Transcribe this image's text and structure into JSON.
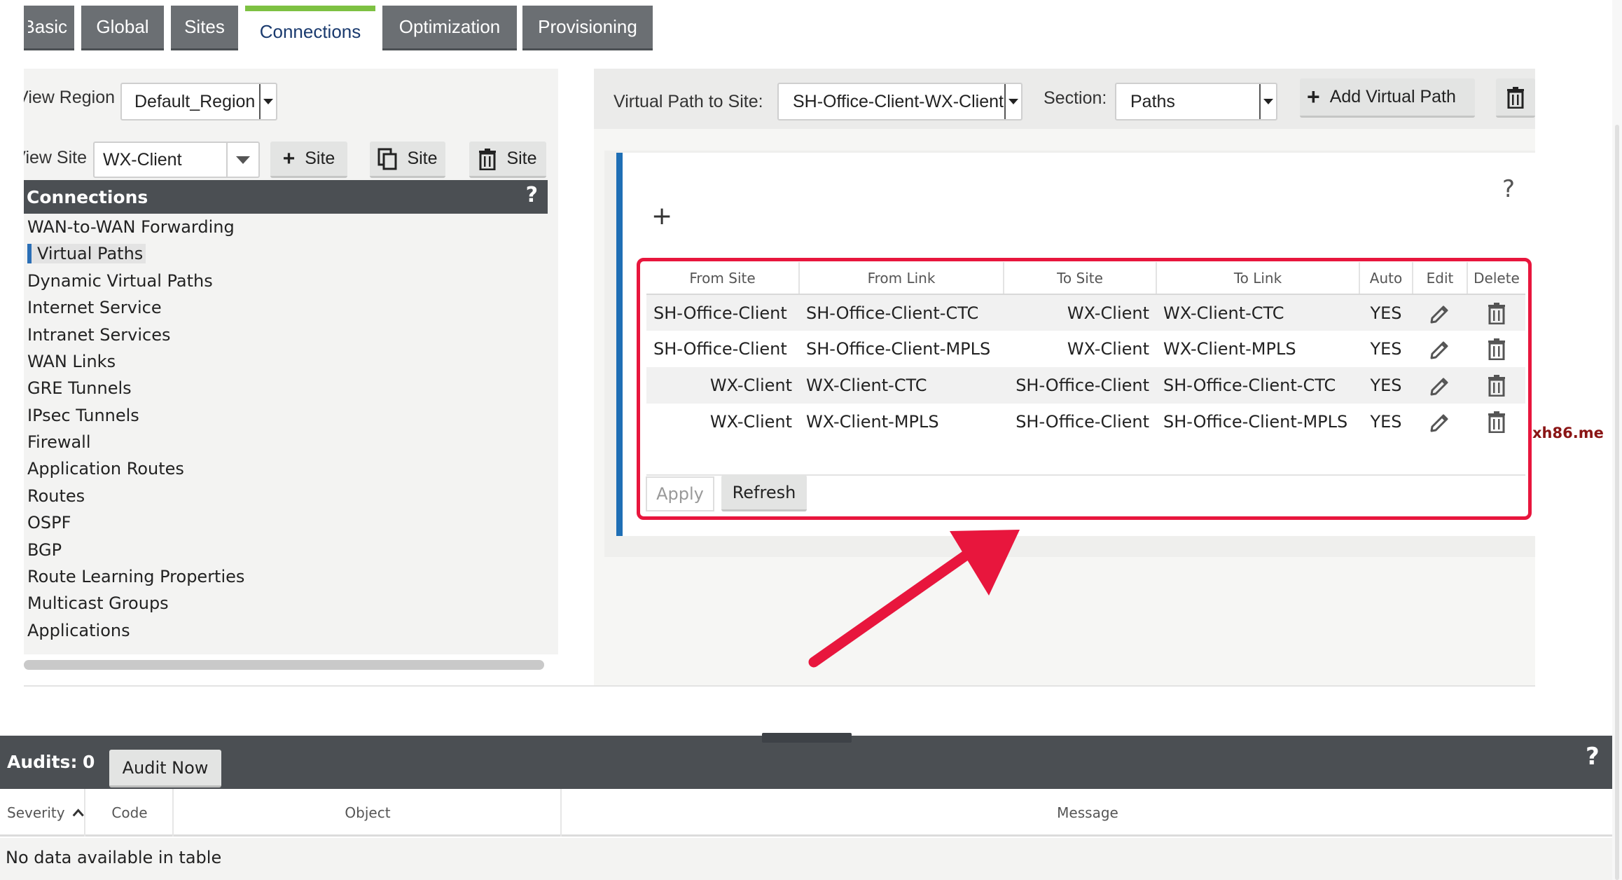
{
  "tabs": [
    "Basic",
    "Global",
    "Sites",
    "Connections",
    "Optimization",
    "Provisioning"
  ],
  "left": {
    "view_region_label": "View Region:",
    "view_region_value": "Default_Region",
    "view_site_label": "View Site:",
    "view_site_value": "WX-Client",
    "add_site": "Site",
    "clone_site": "Site",
    "delete_site": "Site",
    "connections_title": "Connections",
    "help": "?",
    "nav": [
      "WAN-to-WAN Forwarding",
      "Virtual Paths",
      "Dynamic Virtual Paths",
      "Internet Service",
      "Intranet Services",
      "WAN Links",
      "GRE Tunnels",
      "IPsec Tunnels",
      "Firewall",
      "Application Routes",
      "Routes",
      "OSPF",
      "BGP",
      "Route Learning Properties",
      "Multicast Groups",
      "Applications"
    ]
  },
  "toolbar": {
    "vp_label": "Virtual Path to Site:",
    "vp_value": "SH-Office-Client-WX-Client",
    "section_label": "Section:",
    "section_value": "Paths",
    "add_vp": "Add Virtual Path"
  },
  "paths": {
    "add": "+",
    "help": "?",
    "columns": [
      "From Site",
      "From Link",
      "To Site",
      "To Link",
      "Auto",
      "Edit",
      "Delete"
    ],
    "rows": [
      [
        "SH-Office-Client",
        "SH-Office-Client-CTC",
        "WX-Client",
        "WX-Client-CTC",
        "YES"
      ],
      [
        "SH-Office-Client",
        "SH-Office-Client-MPLS",
        "WX-Client",
        "WX-Client-MPLS",
        "YES"
      ],
      [
        "WX-Client",
        "WX-Client-CTC",
        "SH-Office-Client",
        "SH-Office-Client-CTC",
        "YES"
      ],
      [
        "WX-Client",
        "WX-Client-MPLS",
        "SH-Office-Client",
        "SH-Office-Client-MPLS",
        "YES"
      ]
    ],
    "apply": "Apply",
    "refresh": "Refresh"
  },
  "watermark": "xh86.me",
  "audits": {
    "label": "Audits:",
    "count": "0",
    "audit_now": "Audit Now",
    "help": "?",
    "columns": [
      "Severity",
      "Code",
      "Object",
      "Message"
    ],
    "empty": "No data available in table"
  }
}
